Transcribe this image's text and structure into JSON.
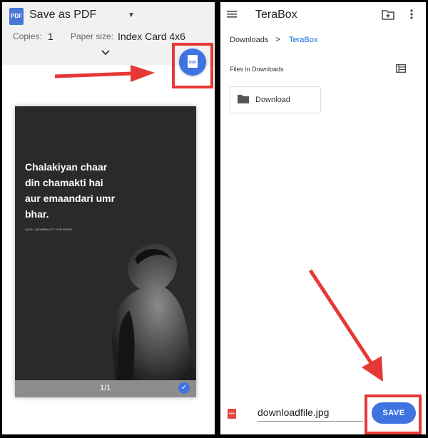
{
  "print_dialog": {
    "printer_name": "Save as PDF",
    "copies_label": "Copies:",
    "copies_value": "1",
    "paper_size_label": "Paper size:",
    "paper_size_value": "Index Card 4x6",
    "fab_icon": "download-pdf-icon",
    "fab_label": "PDF",
    "preview": {
      "quote_lines": [
        "Chalakiyan chaar",
        "din chamakti hai",
        "aur emaandari umr",
        "bhar."
      ],
      "credit": "ACID: LADIBBALOT FOR MORE",
      "page_indicator": "1/1"
    }
  },
  "file_picker": {
    "app_title": "TeraBox",
    "breadcrumb": [
      "Downloads",
      "TeraBox"
    ],
    "breadcrumb_separator": ">",
    "section_label": "Files in Downloads",
    "folders": [
      "Download"
    ],
    "file_type_icon": "PDF",
    "filename": "downloadfile.jpg",
    "save_label": "SAVE"
  },
  "colors": {
    "accent_blue": "#3f73e0",
    "annotation_red": "#e53935",
    "link_blue": "#1a73e8"
  }
}
